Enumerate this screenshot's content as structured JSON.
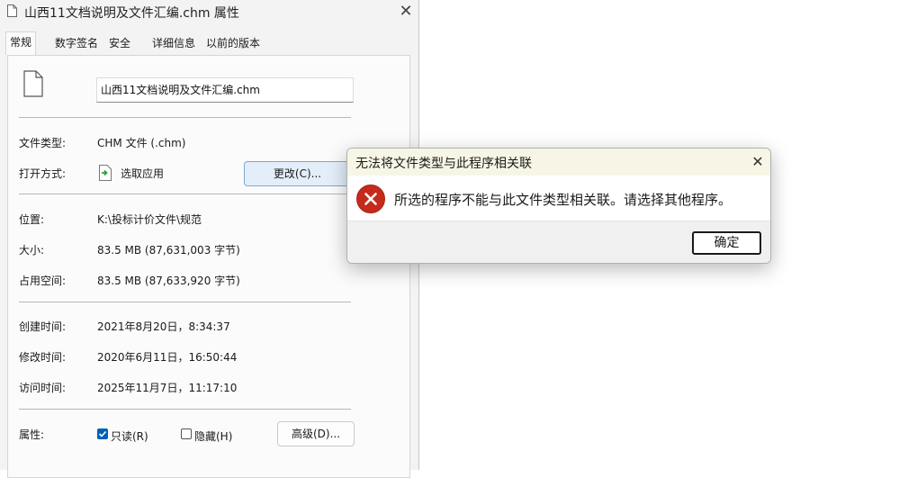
{
  "window": {
    "title": "山西11文档说明及文件汇编.chm 属性",
    "close_glyph": "✕"
  },
  "tabs": [
    {
      "label": "常规"
    },
    {
      "label": "数字签名"
    },
    {
      "label": "安全"
    },
    {
      "label": "详细信息"
    },
    {
      "label": "以前的版本"
    }
  ],
  "general": {
    "filename": "山西11文档说明及文件汇编.chm",
    "file_type_label": "文件类型:",
    "file_type_value": "CHM 文件 (.chm)",
    "open_with_label": "打开方式:",
    "open_with_value": "选取应用",
    "change_button": "更改(C)...",
    "location_label": "位置:",
    "location_value": "K:\\投标计价文件\\规范",
    "size_label": "大小:",
    "size_value": "83.5 MB (87,631,003 字节)",
    "disk_size_label": "占用空间:",
    "disk_size_value": "83.5 MB (87,633,920 字节)",
    "created_label": "创建时间:",
    "created_value": "2021年8月20日，8:34:37",
    "modified_label": "修改时间:",
    "modified_value": "2020年6月11日，16:50:44",
    "accessed_label": "访问时间:",
    "accessed_value": "2025年11月7日，11:17:10",
    "attributes_label": "属性:",
    "readonly_label": "只读(R)",
    "readonly_checked": true,
    "hidden_label": "隐藏(H)",
    "hidden_checked": false,
    "advanced_button": "高级(D)..."
  },
  "dialog": {
    "title": "无法将文件类型与此程序相关联",
    "message": "所选的程序不能与此文件类型相关联。请选择其他程序。",
    "ok_button": "确定",
    "close_glyph": "✕",
    "error_color": "#c42b1c"
  }
}
